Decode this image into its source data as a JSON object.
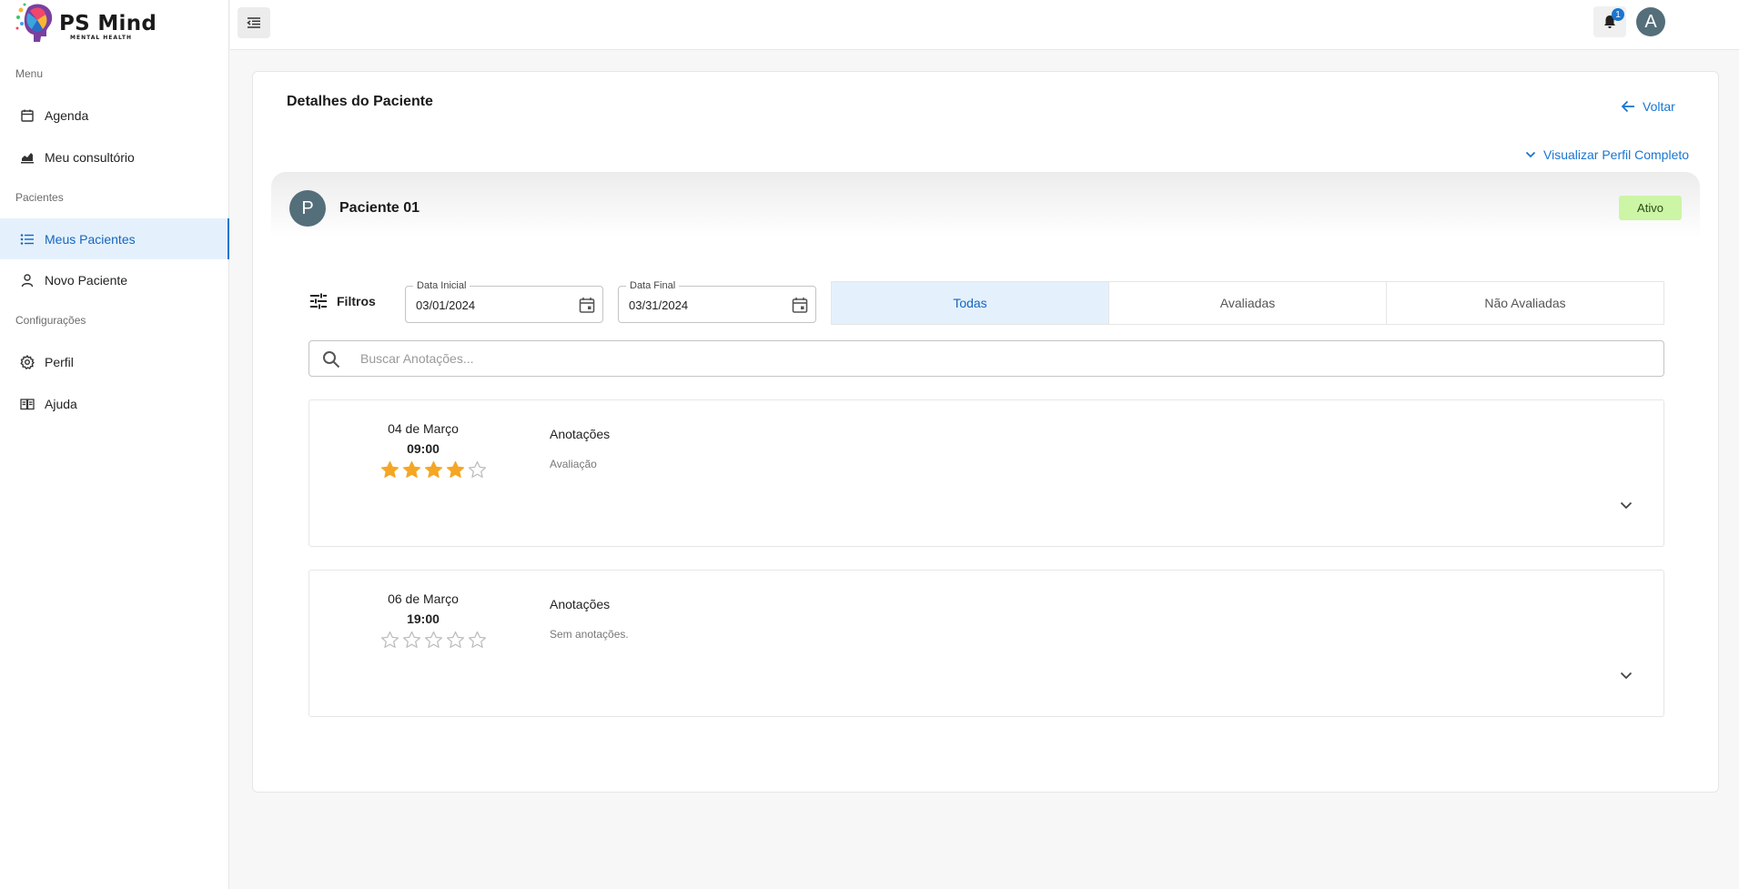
{
  "brand": {
    "name": "PS Mind",
    "tagline": "MENTAL HEALTH"
  },
  "sidebar": {
    "sections": [
      {
        "label": "Menu",
        "items": [
          {
            "label": "Agenda",
            "icon": "calendar-icon"
          },
          {
            "label": "Meu consultório",
            "icon": "bar-chart-icon"
          }
        ]
      },
      {
        "label": "Pacientes",
        "items": [
          {
            "label": "Meus Pacientes",
            "icon": "list-icon",
            "active": true
          },
          {
            "label": "Novo Paciente",
            "icon": "person-icon"
          }
        ]
      },
      {
        "label": "Configurações",
        "items": [
          {
            "label": "Perfil",
            "icon": "gear-icon"
          },
          {
            "label": "Ajuda",
            "icon": "book-icon"
          }
        ]
      }
    ]
  },
  "topbar": {
    "notification_count": "1",
    "user_initial": "A"
  },
  "page": {
    "title": "Detalhes do Paciente",
    "back_label": "Voltar",
    "profile_link": "Visualizar Perfil Completo"
  },
  "patient": {
    "initial": "P",
    "name": "Paciente 01",
    "status": "Ativo",
    "status_color": "#ccf5a6"
  },
  "filters": {
    "label": "Filtros",
    "start_date": {
      "label": "Data Inicial",
      "value": "03/01/2024"
    },
    "end_date": {
      "label": "Data Final",
      "value": "03/31/2024"
    },
    "tabs": [
      {
        "label": "Todas",
        "active": true
      },
      {
        "label": "Avaliadas"
      },
      {
        "label": "Não Avaliadas"
      }
    ]
  },
  "search": {
    "placeholder": "Buscar Anotações..."
  },
  "sessions": [
    {
      "date": "04 de Março",
      "time": "09:00",
      "rating": 4,
      "max_rating": 5,
      "notes_title": "Anotações",
      "notes_text": "Avaliação"
    },
    {
      "date": "06 de Março",
      "time": "19:00",
      "rating": 0,
      "max_rating": 5,
      "notes_title": "Anotações",
      "notes_text": "Sem anotações."
    }
  ],
  "colors": {
    "accent": "#1976d2",
    "active_bg": "#e4f1fc",
    "star": "#f5a623"
  }
}
